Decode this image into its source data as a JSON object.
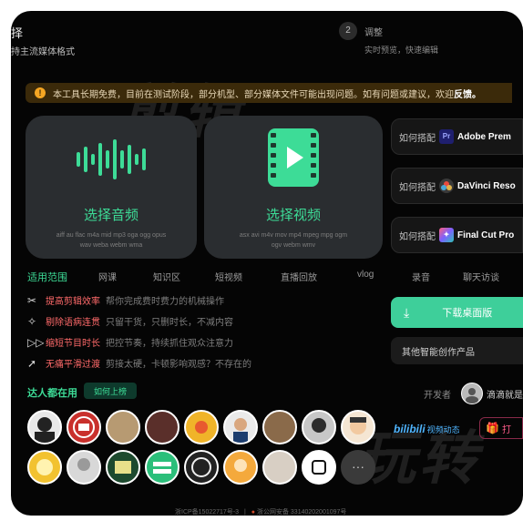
{
  "header": {
    "step_fragment": "择",
    "subtitle_fragment": "持主流媒体格式",
    "step2_number": "2",
    "step2_title": "调整",
    "step2_sub": "实时预览，快速编辑"
  },
  "notice": {
    "text": "本工具长期免费，目前在测试阶段，部分机型、部分媒体文件可能出现问题。如有问题或建议，欢迎",
    "link": "反馈。"
  },
  "watermark": {
    "line1": "剪辑",
    "line2": "玩转"
  },
  "audio_card": {
    "title": "选择音频",
    "formats_line1": "aiff au flac m4a mid mp3 oga ogg opus",
    "formats_line2": "wav weba webm wma"
  },
  "video_card": {
    "title": "选择视频",
    "formats_line1": "asx avi m4v mov mp4 mpeg mpg ogm",
    "formats_line2": "ogv webm wmv"
  },
  "integrations": [
    {
      "how": "如何搭配",
      "icon": "premiere-icon",
      "name": "Adobe Prem"
    },
    {
      "how": "如何搭配",
      "icon": "davinci-icon",
      "name": "DaVinci Reso"
    },
    {
      "how": "如何搭配",
      "icon": "finalcut-icon",
      "name": "Final Cut Pro"
    }
  ],
  "scope": {
    "label": "适用范围",
    "items": [
      "网课",
      "知识区",
      "短视频",
      "直播回放",
      "vlog",
      "录音",
      "聊天访谈"
    ]
  },
  "features": [
    {
      "icon": "scissors-icon",
      "key": "提高剪辑效率",
      "value": "帮你完成费时费力的机械操作"
    },
    {
      "icon": "sparkle-icon",
      "key": "剔除语病连贯",
      "value": "只留干货，只删时长，不减内容"
    },
    {
      "icon": "fast-forward-icon",
      "key": "缩短节目时长",
      "value": "把控节奏，持续抓住观众注意力"
    },
    {
      "icon": "rocket-icon",
      "key": "无痛平滑过渡",
      "value": "剪接太硬，卡顿影响观感？不存在的"
    }
  ],
  "users": {
    "label": "达人都在用",
    "button": "如何上榜"
  },
  "download": {
    "label": "下载桌面版"
  },
  "other_products": "其他智能创作产品",
  "developer": {
    "label": "开发者",
    "name": "滴滴就是"
  },
  "links": {
    "bilibili": "bilibili",
    "bilibili_suffix": "视频动态",
    "gift": "打"
  },
  "footer": {
    "icp": "浙ICP备15022717号-3",
    "sep": "|",
    "police": "浙公网安备 33140202001097号"
  },
  "colors": {
    "accent": "#3ddc97",
    "background": "#050505",
    "card": "#2a2d30",
    "warning": "#f5a623"
  }
}
